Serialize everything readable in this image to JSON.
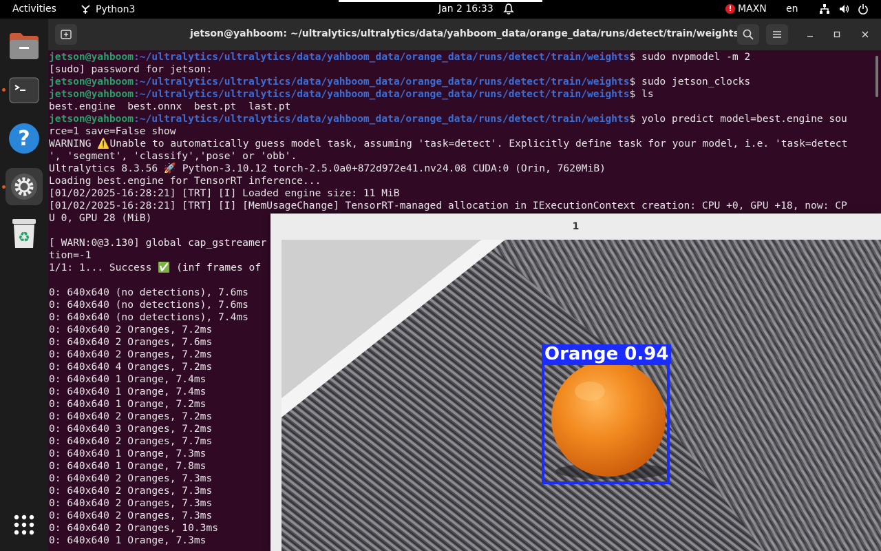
{
  "topbar": {
    "activities": "Activities",
    "app_name": "Python3",
    "datetime": "Jan 2  16:33",
    "power_mode": "MAXN",
    "language": "en"
  },
  "terminal": {
    "title": "jetson@yahboom: ~/ultralytics/ultralytics/data/yahboom_data/orange_data/runs/detect/train/weights",
    "prompt_user": "jetson@yahboom",
    "prompt_path": ":~/ultralytics/ultralytics/data/yahboom_data/orange_data/runs/detect/train/weights",
    "cmd1": "$ sudo nvpmodel -m 2",
    "sudo_prompt": "[sudo] password for jetson:",
    "cmd2": "$ sudo jetson_clocks",
    "cmd3": "$ ls",
    "ls_output": "best.engine  best.onnx  best.pt  last.pt",
    "cmd4": "$ yolo predict model=best.engine sou",
    "cmd4_cont": "rce=1 save=False show",
    "warn1": "WARNING ⚠️Unable to automatically guess model task, assuming 'task=detect'. Explicitly define task for your model, i.e. 'task=detect",
    "warn2": "', 'segment', 'classify','pose' or 'obb'.",
    "version": "Ultralytics 8.3.56 🚀 Python-3.10.12 torch-2.5.0a0+872d972e41.nv24.08 CUDA:0 (Orin, 7620MiB)",
    "loading": "Loading best.engine for TensorRT inference...",
    "trt1": "[01/02/2025-16:28:21] [TRT] [I] Loaded engine size: 11 MiB",
    "trt2": "[01/02/2025-16:28:21] [TRT] [I] [MemUsageChange] TensorRT-managed allocation in IExecutionContext creation: CPU +0, GPU +18, now: CP",
    "trt3": "U 0, GPU 28 (MiB)",
    "gst_warn": "[ WARN:0@3.130] global cap_gstreamer",
    "gst_cont": "tion=-1",
    "success": "1/1: 1... Success ✅ (inf frames of",
    "detections": [
      "0: 640x640 (no detections), 7.6ms",
      "0: 640x640 (no detections), 7.6ms",
      "0: 640x640 (no detections), 7.4ms",
      "0: 640x640 2 Oranges, 7.2ms",
      "0: 640x640 2 Oranges, 7.6ms",
      "0: 640x640 2 Oranges, 7.2ms",
      "0: 640x640 4 Oranges, 7.2ms",
      "0: 640x640 1 Orange, 7.4ms",
      "0: 640x640 1 Orange, 7.4ms",
      "0: 640x640 1 Orange, 7.2ms",
      "0: 640x640 2 Oranges, 7.2ms",
      "0: 640x640 3 Oranges, 7.2ms",
      "0: 640x640 2 Oranges, 7.7ms",
      "0: 640x640 1 Orange, 7.3ms",
      "0: 640x640 1 Orange, 7.8ms",
      "0: 640x640 2 Oranges, 7.3ms",
      "0: 640x640 2 Oranges, 7.3ms",
      "0: 640x640 2 Oranges, 7.3ms",
      "0: 640x640 2 Oranges, 7.3ms",
      "0: 640x640 2 Oranges, 10.3ms",
      "0: 640x640 1 Orange, 7.3ms"
    ]
  },
  "image_window": {
    "title": "1",
    "detection_label": "Orange 0.94"
  },
  "dock": {
    "icons": [
      "files-icon",
      "terminal-icon",
      "help-icon",
      "settings-icon",
      "trash-icon",
      "app-grid-icon"
    ]
  },
  "colors": {
    "terminal_bg": "#300a24",
    "prompt_green": "#26a269",
    "path_blue": "#3b6fd6",
    "bbox_blue": "#1a2cff",
    "accent_orange": "#e95420"
  }
}
